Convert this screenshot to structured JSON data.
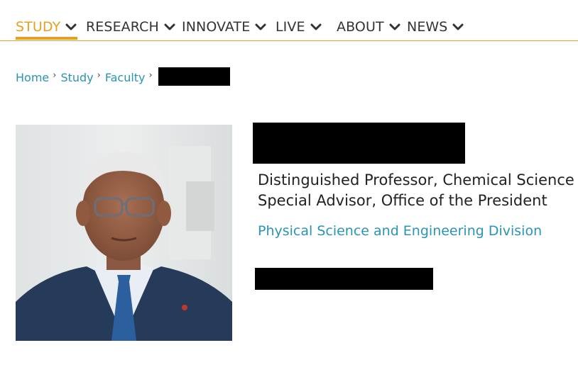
{
  "nav": {
    "items": [
      {
        "label": "STUDY",
        "active": true
      },
      {
        "label": "RESEARCH",
        "active": false
      },
      {
        "label": "INNOVATE",
        "active": false
      },
      {
        "label": "LIVE",
        "active": false
      },
      {
        "label": "ABOUT",
        "active": false
      },
      {
        "label": "NEWS",
        "active": false
      }
    ],
    "accent_color": "#e3a023",
    "chevron_icon": "chevron-down-icon"
  },
  "breadcrumb": {
    "items": [
      "Home",
      "Study",
      "Faculty"
    ],
    "separator_icon": "chevron-right-icon",
    "last_item_redacted": true,
    "link_color": "#2b93b5"
  },
  "profile": {
    "photo_alt": "portrait photo",
    "name_redacted": true,
    "titles": [
      "Distinguished Professor, Chemical Science",
      "Special Advisor, Office of the President"
    ],
    "division": "Physical Science and Engineering Division",
    "contact_redacted": true
  }
}
